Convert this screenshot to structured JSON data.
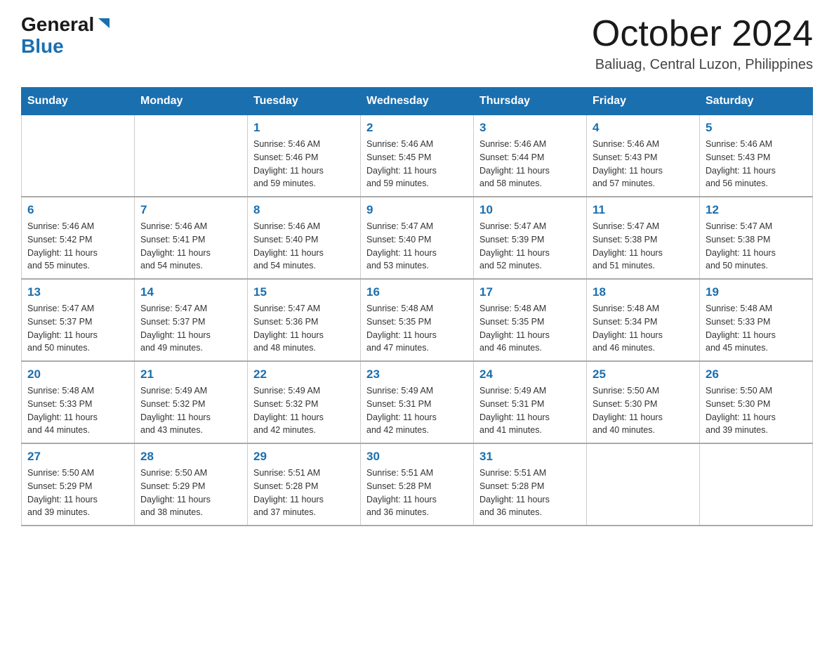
{
  "header": {
    "logo_general": "General",
    "logo_blue": "Blue",
    "month_title": "October 2024",
    "location": "Baliuag, Central Luzon, Philippines"
  },
  "days_of_week": [
    "Sunday",
    "Monday",
    "Tuesday",
    "Wednesday",
    "Thursday",
    "Friday",
    "Saturday"
  ],
  "weeks": [
    [
      {
        "day": "",
        "info": ""
      },
      {
        "day": "",
        "info": ""
      },
      {
        "day": "1",
        "info": "Sunrise: 5:46 AM\nSunset: 5:46 PM\nDaylight: 11 hours\nand 59 minutes."
      },
      {
        "day": "2",
        "info": "Sunrise: 5:46 AM\nSunset: 5:45 PM\nDaylight: 11 hours\nand 59 minutes."
      },
      {
        "day": "3",
        "info": "Sunrise: 5:46 AM\nSunset: 5:44 PM\nDaylight: 11 hours\nand 58 minutes."
      },
      {
        "day": "4",
        "info": "Sunrise: 5:46 AM\nSunset: 5:43 PM\nDaylight: 11 hours\nand 57 minutes."
      },
      {
        "day": "5",
        "info": "Sunrise: 5:46 AM\nSunset: 5:43 PM\nDaylight: 11 hours\nand 56 minutes."
      }
    ],
    [
      {
        "day": "6",
        "info": "Sunrise: 5:46 AM\nSunset: 5:42 PM\nDaylight: 11 hours\nand 55 minutes."
      },
      {
        "day": "7",
        "info": "Sunrise: 5:46 AM\nSunset: 5:41 PM\nDaylight: 11 hours\nand 54 minutes."
      },
      {
        "day": "8",
        "info": "Sunrise: 5:46 AM\nSunset: 5:40 PM\nDaylight: 11 hours\nand 54 minutes."
      },
      {
        "day": "9",
        "info": "Sunrise: 5:47 AM\nSunset: 5:40 PM\nDaylight: 11 hours\nand 53 minutes."
      },
      {
        "day": "10",
        "info": "Sunrise: 5:47 AM\nSunset: 5:39 PM\nDaylight: 11 hours\nand 52 minutes."
      },
      {
        "day": "11",
        "info": "Sunrise: 5:47 AM\nSunset: 5:38 PM\nDaylight: 11 hours\nand 51 minutes."
      },
      {
        "day": "12",
        "info": "Sunrise: 5:47 AM\nSunset: 5:38 PM\nDaylight: 11 hours\nand 50 minutes."
      }
    ],
    [
      {
        "day": "13",
        "info": "Sunrise: 5:47 AM\nSunset: 5:37 PM\nDaylight: 11 hours\nand 50 minutes."
      },
      {
        "day": "14",
        "info": "Sunrise: 5:47 AM\nSunset: 5:37 PM\nDaylight: 11 hours\nand 49 minutes."
      },
      {
        "day": "15",
        "info": "Sunrise: 5:47 AM\nSunset: 5:36 PM\nDaylight: 11 hours\nand 48 minutes."
      },
      {
        "day": "16",
        "info": "Sunrise: 5:48 AM\nSunset: 5:35 PM\nDaylight: 11 hours\nand 47 minutes."
      },
      {
        "day": "17",
        "info": "Sunrise: 5:48 AM\nSunset: 5:35 PM\nDaylight: 11 hours\nand 46 minutes."
      },
      {
        "day": "18",
        "info": "Sunrise: 5:48 AM\nSunset: 5:34 PM\nDaylight: 11 hours\nand 46 minutes."
      },
      {
        "day": "19",
        "info": "Sunrise: 5:48 AM\nSunset: 5:33 PM\nDaylight: 11 hours\nand 45 minutes."
      }
    ],
    [
      {
        "day": "20",
        "info": "Sunrise: 5:48 AM\nSunset: 5:33 PM\nDaylight: 11 hours\nand 44 minutes."
      },
      {
        "day": "21",
        "info": "Sunrise: 5:49 AM\nSunset: 5:32 PM\nDaylight: 11 hours\nand 43 minutes."
      },
      {
        "day": "22",
        "info": "Sunrise: 5:49 AM\nSunset: 5:32 PM\nDaylight: 11 hours\nand 42 minutes."
      },
      {
        "day": "23",
        "info": "Sunrise: 5:49 AM\nSunset: 5:31 PM\nDaylight: 11 hours\nand 42 minutes."
      },
      {
        "day": "24",
        "info": "Sunrise: 5:49 AM\nSunset: 5:31 PM\nDaylight: 11 hours\nand 41 minutes."
      },
      {
        "day": "25",
        "info": "Sunrise: 5:50 AM\nSunset: 5:30 PM\nDaylight: 11 hours\nand 40 minutes."
      },
      {
        "day": "26",
        "info": "Sunrise: 5:50 AM\nSunset: 5:30 PM\nDaylight: 11 hours\nand 39 minutes."
      }
    ],
    [
      {
        "day": "27",
        "info": "Sunrise: 5:50 AM\nSunset: 5:29 PM\nDaylight: 11 hours\nand 39 minutes."
      },
      {
        "day": "28",
        "info": "Sunrise: 5:50 AM\nSunset: 5:29 PM\nDaylight: 11 hours\nand 38 minutes."
      },
      {
        "day": "29",
        "info": "Sunrise: 5:51 AM\nSunset: 5:28 PM\nDaylight: 11 hours\nand 37 minutes."
      },
      {
        "day": "30",
        "info": "Sunrise: 5:51 AM\nSunset: 5:28 PM\nDaylight: 11 hours\nand 36 minutes."
      },
      {
        "day": "31",
        "info": "Sunrise: 5:51 AM\nSunset: 5:28 PM\nDaylight: 11 hours\nand 36 minutes."
      },
      {
        "day": "",
        "info": ""
      },
      {
        "day": "",
        "info": ""
      }
    ]
  ]
}
